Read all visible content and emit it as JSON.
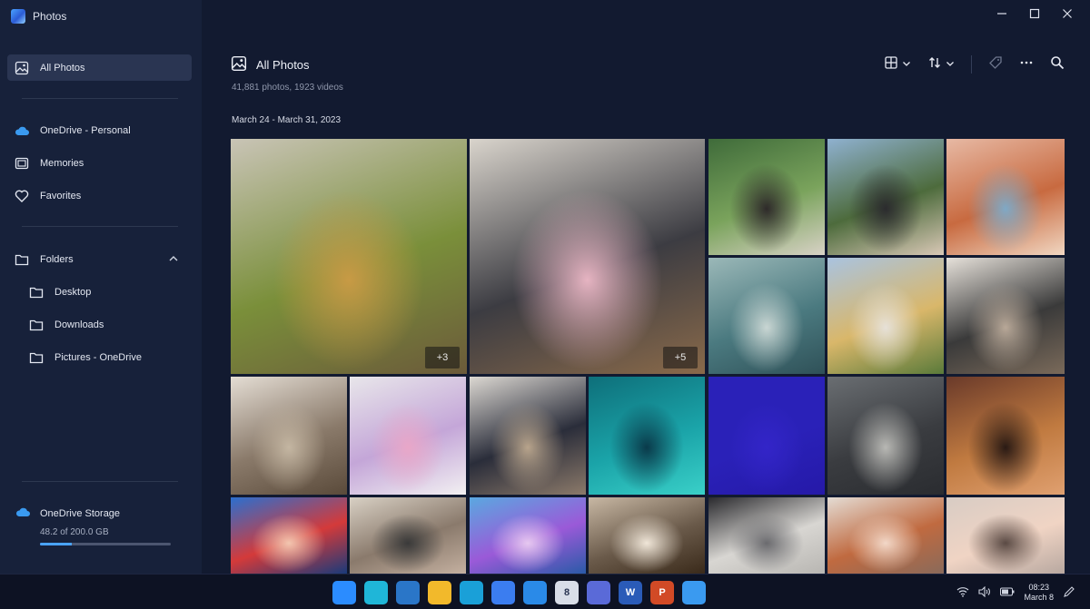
{
  "app": {
    "title": "Photos",
    "logo_icon": "photos-app-logo"
  },
  "sidebar": {
    "items": [
      {
        "label": "All Photos",
        "icon": "photo-gallery-icon",
        "active": true
      },
      {
        "label": "OneDrive - Personal",
        "icon": "cloud-icon"
      },
      {
        "label": "Memories",
        "icon": "memories-icon"
      },
      {
        "label": "Favorites",
        "icon": "heart-icon"
      },
      {
        "label": "Folders",
        "icon": "folder-icon",
        "expanded": true
      }
    ],
    "folders": [
      {
        "label": "Desktop",
        "icon": "folder-icon"
      },
      {
        "label": "Downloads",
        "icon": "folder-icon"
      },
      {
        "label": "Pictures - OneDrive",
        "icon": "folder-icon"
      }
    ],
    "storage": {
      "label": "OneDrive Storage",
      "usage": "48.2 of 200.0 GB",
      "used_fraction": 0.241
    }
  },
  "header": {
    "title": "All Photos",
    "subtitle": "41,881 photos, 1923 videos",
    "date_range": "March 24 - March 31, 2023"
  },
  "toolbar": {
    "buttons": [
      "view-layout-icon",
      "sort-icon",
      "tag-icon",
      "more-icon",
      "search-icon"
    ]
  },
  "tiles": [
    {
      "name": "photo-toddler-park-autumn",
      "badge": "+3",
      "colors": [
        "#c9c4b6",
        "#7a8f3a",
        "#c89a45",
        "#6b5a3a"
      ]
    },
    {
      "name": "photo-toddler-pink-dress-armchair",
      "badge": "+5",
      "colors": [
        "#d9d4cc",
        "#3c3c42",
        "#e6b4c2",
        "#8a6a4a"
      ]
    },
    {
      "name": "photo-couple-bench-garden",
      "colors": [
        "#3f6b3a",
        "#7aa35c",
        "#2e2a2a",
        "#d8d2c6"
      ]
    },
    {
      "name": "photo-man-outdoors",
      "colors": [
        "#8fb1d0",
        "#4d6b3c",
        "#2b2b2e",
        "#d9c8b6"
      ]
    },
    {
      "name": "photo-abstract-ribbons-orange",
      "colors": [
        "#e7b9a4",
        "#c86a40",
        "#7fa9c6",
        "#f1d7c2"
      ]
    },
    {
      "name": "photo-abstract-teal-ribbons",
      "colors": [
        "#9bb8b8",
        "#4b7a80",
        "#c9d6d3",
        "#2f5158"
      ]
    },
    {
      "name": "photo-couple-selfie",
      "colors": [
        "#a9c3e0",
        "#d9b76a",
        "#e6e1d8",
        "#5a7a3a"
      ]
    },
    {
      "name": "photo-balcony-couple",
      "colors": [
        "#e6e1da",
        "#3a3a3a",
        "#b8a898",
        "#7a6a5a"
      ]
    },
    {
      "name": "photo-toddler-sofa",
      "colors": [
        "#e4ddd4",
        "#8a7a6a",
        "#c4b6a2",
        "#5a4a3a"
      ]
    },
    {
      "name": "photo-toddler-snow-hat",
      "colors": [
        "#e8e6ea",
        "#c4a6d8",
        "#e9a7c8",
        "#f2f0f2"
      ]
    },
    {
      "name": "photo-toddler-dress-kitchen",
      "colors": [
        "#dcd8d2",
        "#2a2d3a",
        "#b8a48c",
        "#8c7a6a"
      ]
    },
    {
      "name": "photo-abstract-teal-waves",
      "colors": [
        "#0e6f7a",
        "#1aa3a8",
        "#0a3a4a",
        "#3ad0c8"
      ]
    },
    {
      "name": "photo-solid-indigo",
      "colors": [
        "#2a21b8",
        "#2a21b8",
        "#3325c8",
        "#2519a8"
      ]
    },
    {
      "name": "photo-man-suit-street",
      "colors": [
        "#6a6e72",
        "#3a3c40",
        "#b8b8b4",
        "#2a2c30"
      ]
    },
    {
      "name": "photo-woman-cafe-night",
      "colors": [
        "#6a3a2a",
        "#c07a40",
        "#2a1a14",
        "#e0a070"
      ]
    },
    {
      "name": "photo-toddler-playground",
      "colors": [
        "#2b6fcf",
        "#d43a3a",
        "#f2c6b0",
        "#1a3a7a"
      ]
    },
    {
      "name": "photo-toddler-reading",
      "colors": [
        "#d8d0c4",
        "#8a7a6c",
        "#3a3a3a",
        "#c4b0a0"
      ]
    },
    {
      "name": "photo-abstract-blue-ribbons",
      "colors": [
        "#5aa8e0",
        "#9a5ad8",
        "#e6c8f0",
        "#2a5aa8"
      ]
    },
    {
      "name": "photo-toddler-living-room",
      "colors": [
        "#c8b8a4",
        "#6a5a4a",
        "#f0e6d8",
        "#3a2a1a"
      ]
    },
    {
      "name": "photo-man-laptop-cafe",
      "colors": [
        "#2a2a2e",
        "#d8d6d2",
        "#6a6a6e",
        "#b8b6b2"
      ]
    },
    {
      "name": "photo-toddler-orange-shirt",
      "colors": [
        "#e4dcd4",
        "#c06a40",
        "#f2d8c8",
        "#8a6a5a"
      ]
    },
    {
      "name": "photo-toddler-closeup-smile",
      "colors": [
        "#d8ccc4",
        "#f0d4c4",
        "#5a4a44",
        "#b8a8a0"
      ]
    }
  ],
  "taskbar": {
    "apps": [
      {
        "name": "start-button",
        "glyph": "",
        "color": "#2b8cff"
      },
      {
        "name": "task-view-button",
        "glyph": "",
        "color": "#1fb6d8"
      },
      {
        "name": "search-button",
        "glyph": "",
        "color": "#2a76c8"
      },
      {
        "name": "file-explorer-icon",
        "glyph": "",
        "color": "#f2b92b"
      },
      {
        "name": "edge-browser-icon",
        "glyph": "",
        "color": "#1aa0d8"
      },
      {
        "name": "photos-taskbar-icon",
        "glyph": "",
        "color": "#3b7df0"
      },
      {
        "name": "mail-icon",
        "glyph": "",
        "color": "#2a8ae8"
      },
      {
        "name": "calendar-icon",
        "glyph": "8",
        "color": "#d8dde8"
      },
      {
        "name": "clipchamp-icon",
        "glyph": "",
        "color": "#5a6ad8"
      },
      {
        "name": "word-icon",
        "glyph": "W",
        "color": "#2a5bb8"
      },
      {
        "name": "powerpoint-icon",
        "glyph": "P",
        "color": "#d24a26"
      },
      {
        "name": "downloads-icon",
        "glyph": "",
        "color": "#3a9af0"
      }
    ],
    "clock_time": "08:23",
    "clock_date": "March 8"
  }
}
